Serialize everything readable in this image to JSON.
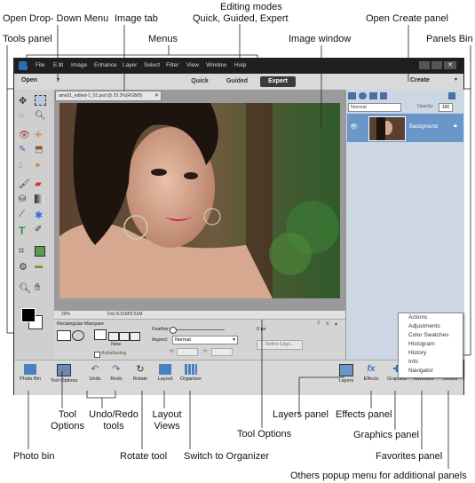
{
  "callouts": {
    "editing_modes_line1": "Editing modes",
    "editing_modes_line2": "Quick, Guided, Expert",
    "open_dropdown": "Open Drop- Down Menu",
    "image_tab": "Image tab",
    "open_create": "Open Create panel",
    "menus": "Menus",
    "tools_panel": "Tools panel",
    "image_window": "Image window",
    "panels_bin": "Panels Bin",
    "tool_options_line1": "Tool",
    "tool_options_line2": "Options",
    "undo_redo_line1": "Undo/Redo",
    "undo_redo_line2": "tools",
    "layout_views_line1": "Layout",
    "layout_views_line2": "Views",
    "tool_options_bottom": "Tool Options",
    "layers_panel": "Layers panel",
    "effects_panel": "Effects panel",
    "graphics_panel": "Graphics panel",
    "photo_bin": "Photo bin",
    "rotate_tool": "Rotate tool",
    "switch_organizer": "Switch to Organizer",
    "favorites_panel": "Favorites panel",
    "others_popup": "Others popup menu for additional panels"
  },
  "app": {
    "menus": [
      "File",
      "Edit",
      "Image",
      "Enhance",
      "Layer",
      "Select",
      "Filter",
      "View",
      "Window",
      "Help"
    ],
    "open_label": "Open",
    "modes": [
      "Quick",
      "Guided",
      "Expert"
    ],
    "active_mode": "Expert",
    "create_label": "Create",
    "image_tab_label": "ams01_edited-1_01.psd @ 29.3%(RGB/8)",
    "zoom": "29%",
    "doc_size": "Doc:9.51M/9.51M",
    "tool_options": {
      "tool_name": "Rectangular Marquee",
      "new_label": "New",
      "antialiasing_label": "Antialiasing",
      "feather_label": "Feather:",
      "feather_value": "0 px",
      "aspect_label": "Aspect:",
      "aspect_value": "Normal",
      "w_label": "W:",
      "h_label": "H:",
      "refine_edge": "Refine Edge..."
    },
    "layers": {
      "blend_mode": "Normal",
      "opacity_label": "Opacity:",
      "opacity_value": "100",
      "layer_name": "Background"
    },
    "taskbar": {
      "photo_bin": "Photo Bin",
      "tool_options": "Tool Options",
      "undo": "Undo",
      "redo": "Redo",
      "rotate": "Rotate",
      "layout": "Layout",
      "organizer": "Organizer",
      "layers": "Layers",
      "effects": "Effects",
      "graphics": "Graphics",
      "favorites": "Favorites",
      "others": "Others"
    },
    "others_menu": [
      "Actions",
      "Adjustments",
      "Color Swatches",
      "Histogram",
      "History",
      "Info",
      "Navigator"
    ]
  }
}
